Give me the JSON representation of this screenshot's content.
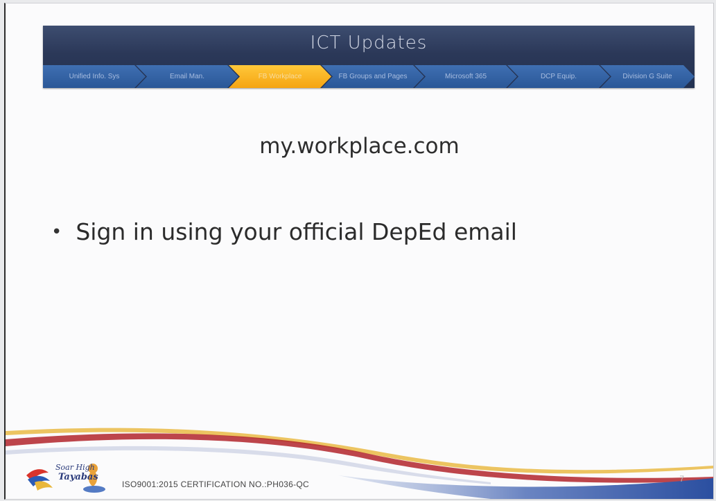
{
  "banner": {
    "title": "ICT Updates",
    "steps": [
      {
        "label": "Unified Info. Sys",
        "active": false
      },
      {
        "label": "Email Man.",
        "active": false
      },
      {
        "label": "FB Workplace",
        "active": true
      },
      {
        "label": "FB Groups and Pages",
        "active": false
      },
      {
        "label": "Microsoft 365",
        "active": false
      },
      {
        "label": "DCP Equip.",
        "active": false
      },
      {
        "label": "Division G Suite",
        "active": false
      }
    ]
  },
  "content": {
    "heading": "my.workplace.com",
    "bullets": [
      "Sign in using your official DepEd email"
    ]
  },
  "footer": {
    "certification": "ISO9001:2015 CERTIFICATION NO.:PH036-QC",
    "page_number": "7",
    "logo_text_line1": "Soar High",
    "logo_text_line2": "Tayabas"
  },
  "colors": {
    "banner": "#2b3858",
    "step": "#2f5d9e",
    "active_step": "#f8b323",
    "swoosh_red": "#b2252c",
    "swoosh_blue": "#2b4fa0",
    "swoosh_gold": "#e9b73a"
  }
}
